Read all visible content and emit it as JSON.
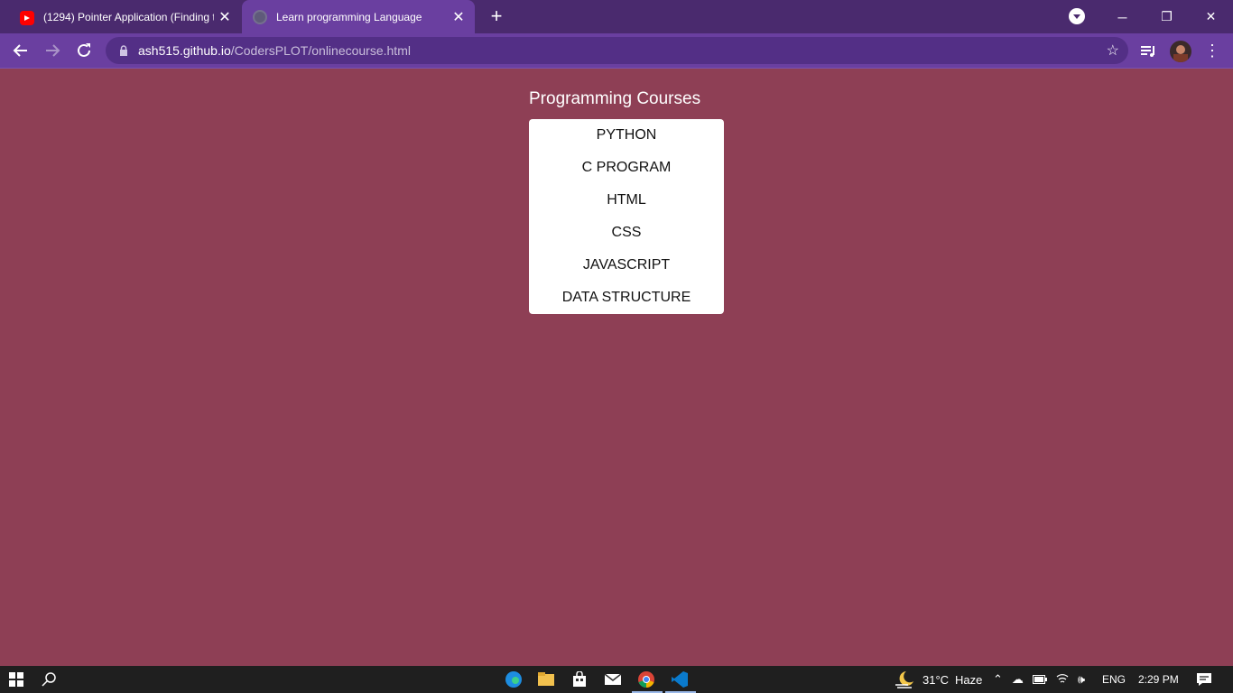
{
  "browser": {
    "tabs": [
      {
        "title": "(1294) Pointer Application (Finding t",
        "icon": "youtube-icon",
        "active": false
      },
      {
        "title": "Learn programming Language",
        "icon": "globe-icon",
        "active": true
      }
    ],
    "url_domain": "ash515.github.io",
    "url_path": "/CodersPLOT/onlinecourse.html"
  },
  "page": {
    "heading": "Programming Courses",
    "courses": [
      "PYTHON",
      "C PROGRAM",
      "HTML",
      "CSS",
      "JAVASCRIPT",
      "DATA STRUCTURE"
    ]
  },
  "taskbar": {
    "weather_temp": "31°C",
    "weather_desc": "Haze",
    "language": "ENG",
    "time": "2:29 PM"
  },
  "colors": {
    "page_bg": "#8e3f55",
    "chrome_frame": "#4a2a6e",
    "chrome_toolbar": "#6a3fa0",
    "course_box": "#ffffff"
  }
}
